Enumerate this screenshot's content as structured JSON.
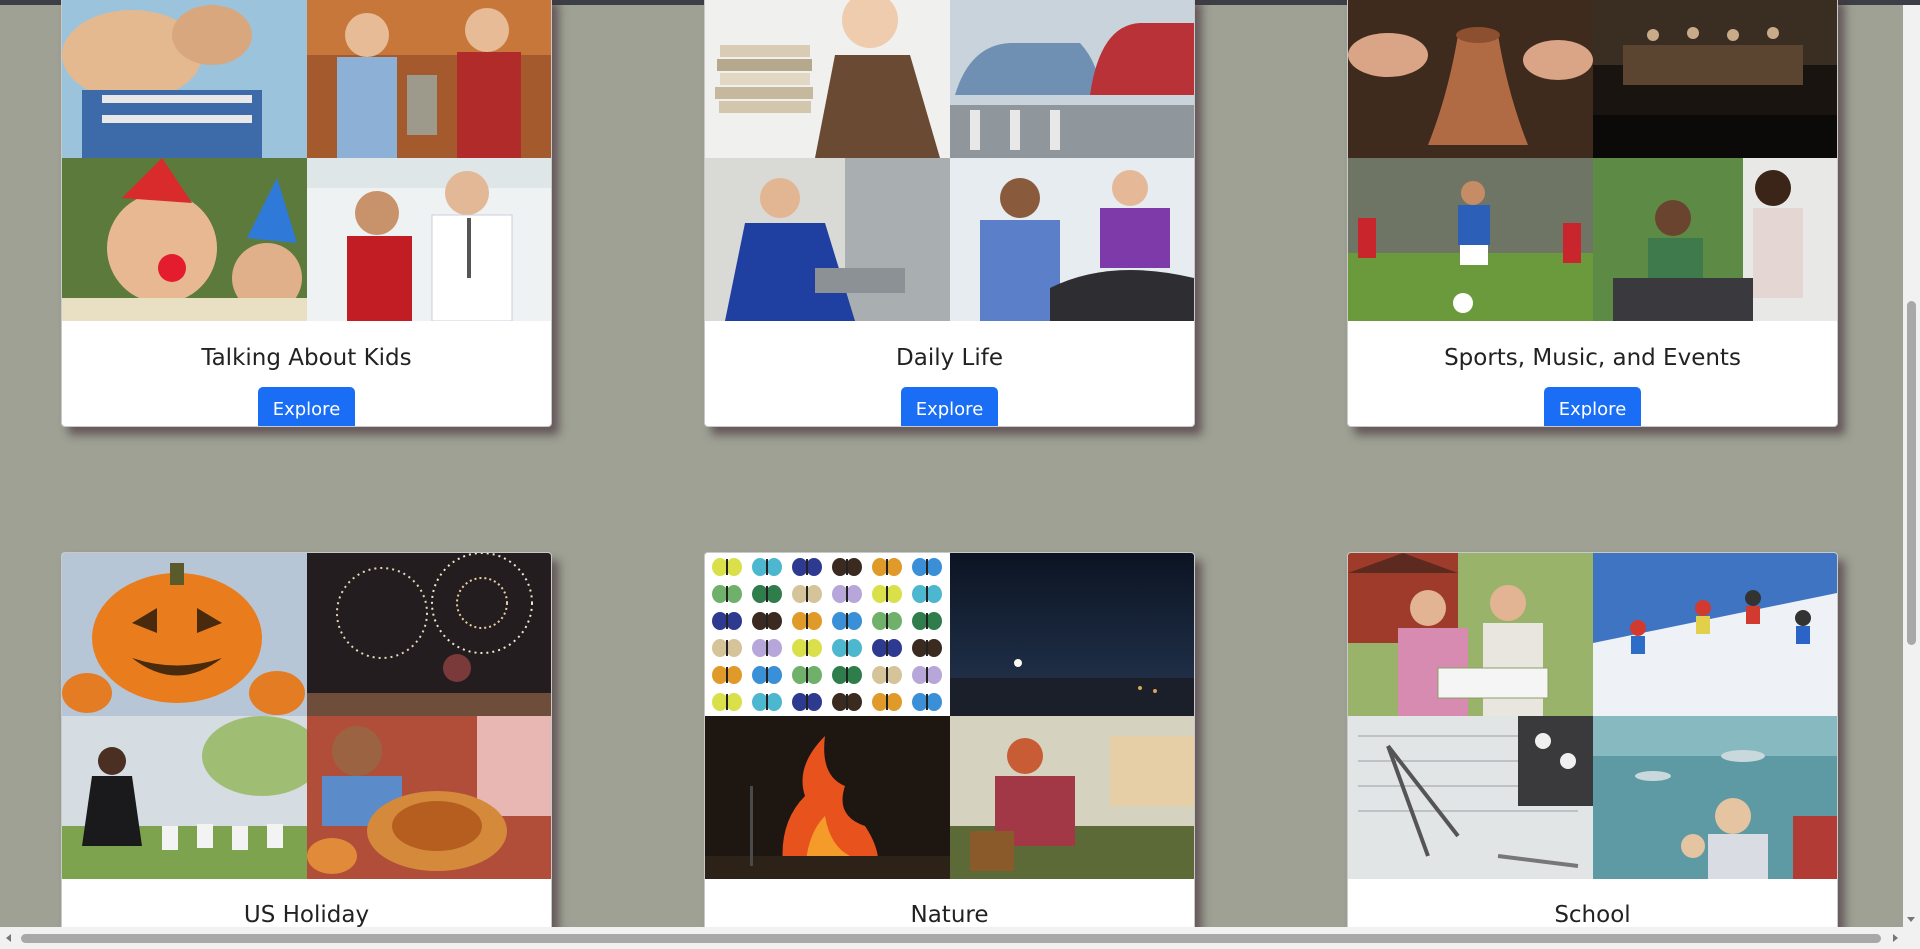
{
  "cards": [
    {
      "title": "Talking About Kids",
      "button": "Explore",
      "tiles": [
        "child-with-band-aid-photo",
        "kids-with-money-photo",
        "birthday-party-kids-photo",
        "boy-with-doctor-photo"
      ]
    },
    {
      "title": "Daily Life",
      "button": "Explore",
      "tiles": [
        "woman-with-books-photo",
        "car-accident-photo",
        "mechanic-at-work-photo",
        "dentist-visit-photo"
      ]
    },
    {
      "title": "Sports, Music, and Events",
      "button": "Explore",
      "tiles": [
        "pottery-making-photo",
        "orchestra-concert-photo",
        "soccer-match-photo",
        "family-barbecue-photo"
      ]
    },
    {
      "title": "US Holiday",
      "button": "",
      "tiles": [
        "halloween-pumpkin-photo",
        "fireworks-photo",
        "memorial-cemetery-photo",
        "thanksgiving-dinner-photo"
      ]
    },
    {
      "title": "Nature",
      "button": "",
      "tiles": [
        "butterfly-collection-photo",
        "night-sky-photo",
        "wildfire-photo",
        "gardening-woman-photo"
      ]
    },
    {
      "title": "School",
      "button": "",
      "tiles": [
        "architecture-model-photo",
        "skiers-photo",
        "math-drawing-tools-photo",
        "aquarium-visit-photo"
      ]
    }
  ],
  "colors": {
    "page_background": "#9ea194",
    "button_blue": "#1a6ef5",
    "card_background": "#ffffff"
  }
}
